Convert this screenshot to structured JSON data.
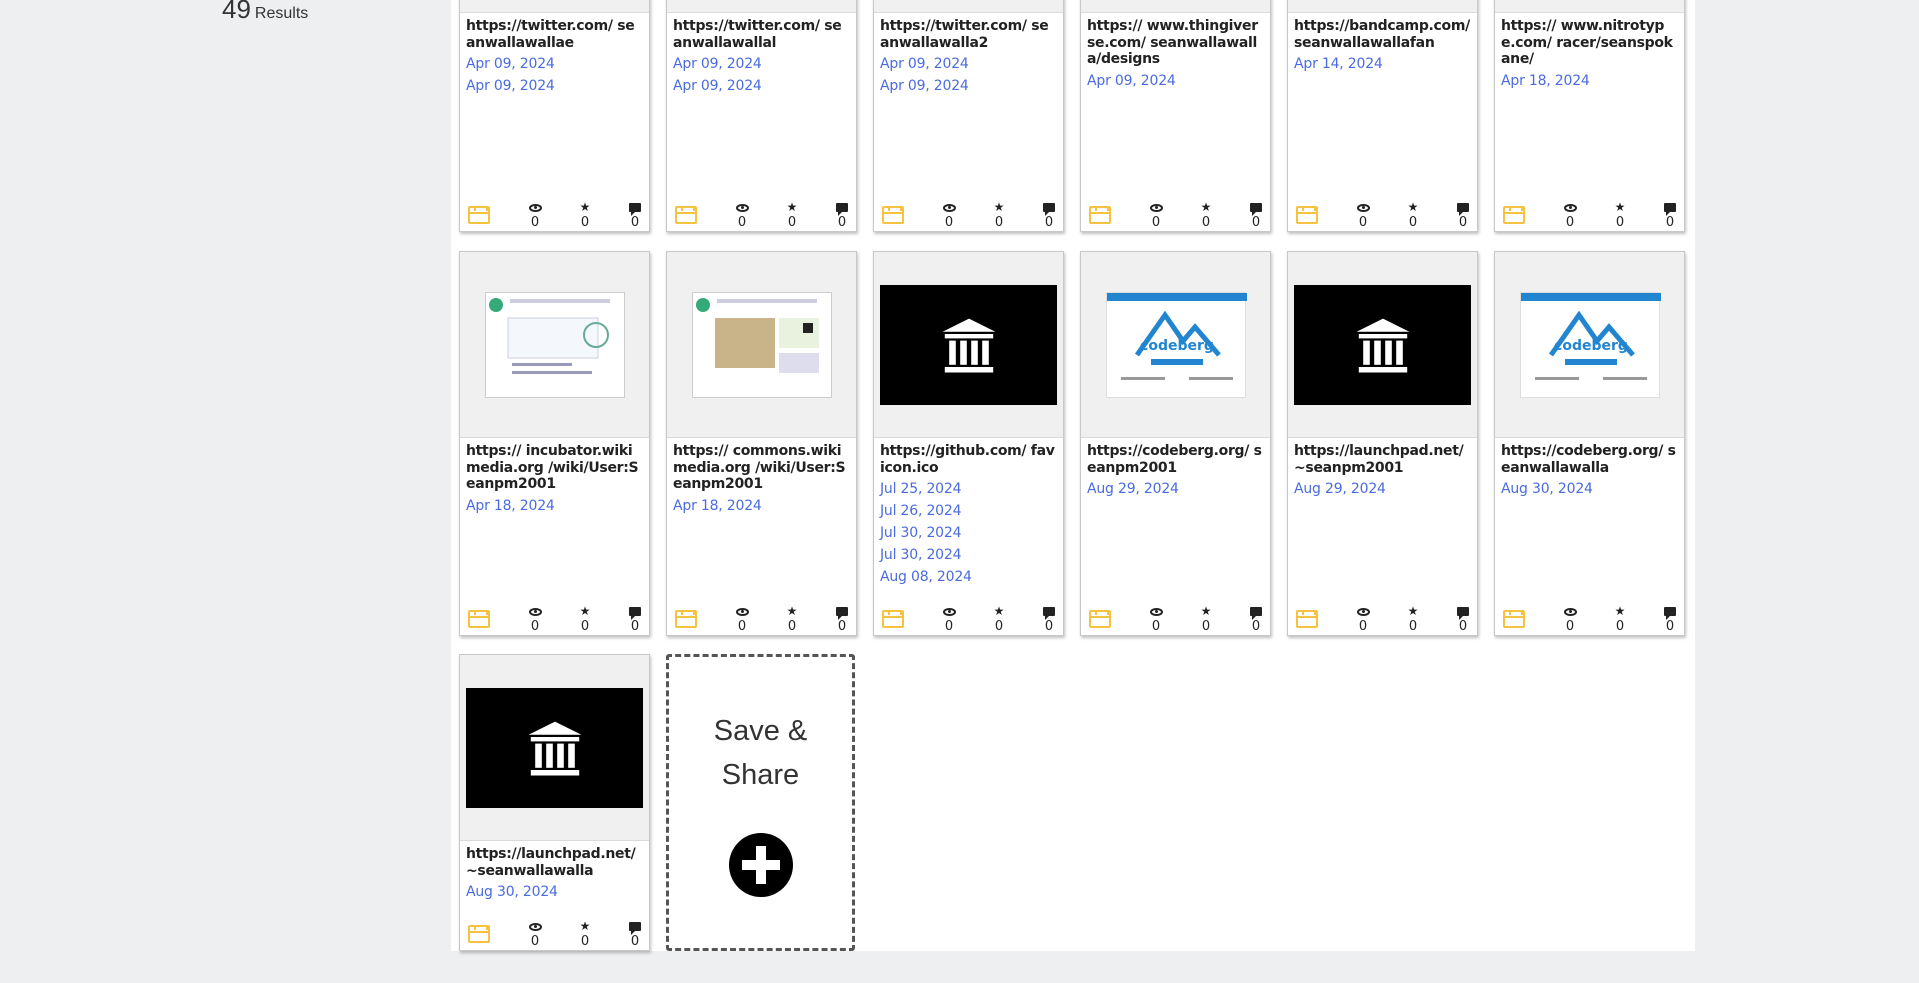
{
  "results": {
    "count": "49",
    "label": "Results"
  },
  "cards_row1": [
    {
      "url": "https://twitter.com/ seanwallawallae",
      "dates": [
        "Apr 09, 2024",
        "Apr 09, 2024"
      ],
      "thumb": "twitter",
      "views": "0",
      "stars": "0",
      "comments": "0"
    },
    {
      "url": "https://twitter.com/ seanwallawallal",
      "dates": [
        "Apr 09, 2024",
        "Apr 09, 2024"
      ],
      "thumb": "twitter",
      "views": "0",
      "stars": "0",
      "comments": "0"
    },
    {
      "url": "https://twitter.com/ seanwallawalla2",
      "dates": [
        "Apr 09, 2024",
        "Apr 09, 2024"
      ],
      "thumb": "twitter",
      "views": "0",
      "stars": "0",
      "comments": "0"
    },
    {
      "url": "https:// www.thingiverse.com/ seanwallawalla/designs",
      "dates": [
        "Apr 09, 2024"
      ],
      "thumb": "archive-logo",
      "views": "0",
      "stars": "0",
      "comments": "0"
    },
    {
      "url": "https://bandcamp.com/ seanwallawallafan",
      "dates": [
        "Apr 14, 2024"
      ],
      "thumb": "bandcamp",
      "views": "0",
      "stars": "0",
      "comments": "0"
    },
    {
      "url": "https:// www.nitrotype.com/ racer/seanspokane/",
      "dates": [
        "Apr 18, 2024"
      ],
      "thumb": "nitrotype",
      "views": "0",
      "stars": "0",
      "comments": "0"
    }
  ],
  "cards_row2": [
    {
      "url": "https:// incubator.wikimedia.org /wiki/User:Seanpm2001",
      "dates": [
        "Apr 18, 2024"
      ],
      "thumb": "wikimedia-incubator",
      "views": "0",
      "stars": "0",
      "comments": "0"
    },
    {
      "url": "https:// commons.wikimedia.org /wiki/User:Seanpm2001",
      "dates": [
        "Apr 18, 2024"
      ],
      "thumb": "wikimedia-commons",
      "views": "0",
      "stars": "0",
      "comments": "0"
    },
    {
      "url": "https://github.com/ favicon.ico",
      "dates": [
        "Jul 25, 2024",
        "Jul 26, 2024",
        "Jul 30, 2024",
        "Jul 30, 2024",
        "Aug 08, 2024"
      ],
      "thumb": "archive-logo",
      "views": "0",
      "stars": "0",
      "comments": "0"
    },
    {
      "url": "https://codeberg.org/ seanpm2001",
      "dates": [
        "Aug 29, 2024"
      ],
      "thumb": "codeberg",
      "views": "0",
      "stars": "0",
      "comments": "0"
    },
    {
      "url": "https://launchpad.net/ ~seanpm2001",
      "dates": [
        "Aug 29, 2024"
      ],
      "thumb": "archive-logo",
      "views": "0",
      "stars": "0",
      "comments": "0"
    },
    {
      "url": "https://codeberg.org/ seanwallawalla",
      "dates": [
        "Aug 30, 2024"
      ],
      "thumb": "codeberg",
      "views": "0",
      "stars": "0",
      "comments": "0"
    }
  ],
  "cards_row3": [
    {
      "url": "https://launchpad.net/ ~seanwallawalla",
      "dates": [
        "Aug 30, 2024"
      ],
      "thumb": "archive-logo",
      "views": "0",
      "stars": "0",
      "comments": "0"
    }
  ],
  "save_share": {
    "label_line1": "Save &",
    "label_line2": "Share",
    "icon": "plus-circle-icon"
  },
  "colors": {
    "date": "#4a6be0",
    "calendar": "#f5c242",
    "twitter": "#1da1f2"
  }
}
